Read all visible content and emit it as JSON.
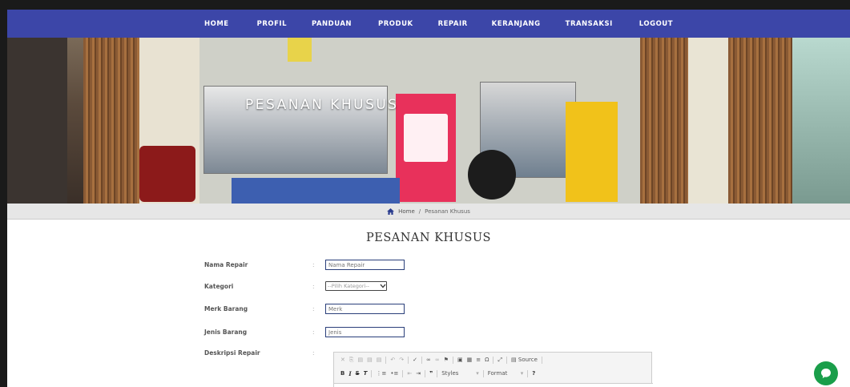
{
  "nav": {
    "items": [
      "HOME",
      "PROFIL",
      "PANDUAN",
      "PRODUK",
      "REPAIR",
      "KERANJANG",
      "TRANSAKSI",
      "LOGOUT"
    ]
  },
  "hero": {
    "title": "PESANAN KHUSUS"
  },
  "breadcrumb": {
    "home": "Home",
    "separator": "/",
    "current": "Pesanan Khusus"
  },
  "page": {
    "title": "PESANAN KHUSUS"
  },
  "form": {
    "colon": ":",
    "nama_label": "Nama Repair",
    "nama_placeholder": "Nama Repair",
    "kategori_label": "Kategori",
    "kategori_value": "--Pilih Kategori--",
    "merk_label": "Merk Barang",
    "merk_placeholder": "Merk",
    "jenis_label": "Jenis Barang",
    "jenis_placeholder": "Jenis",
    "deskripsi_label": "Deskripsi Repair"
  },
  "editor": {
    "source_label": "Source",
    "styles_label": "Styles",
    "format_label": "Format"
  },
  "colors": {
    "nav": "#3c46a8",
    "chat": "#1a9e4a"
  }
}
